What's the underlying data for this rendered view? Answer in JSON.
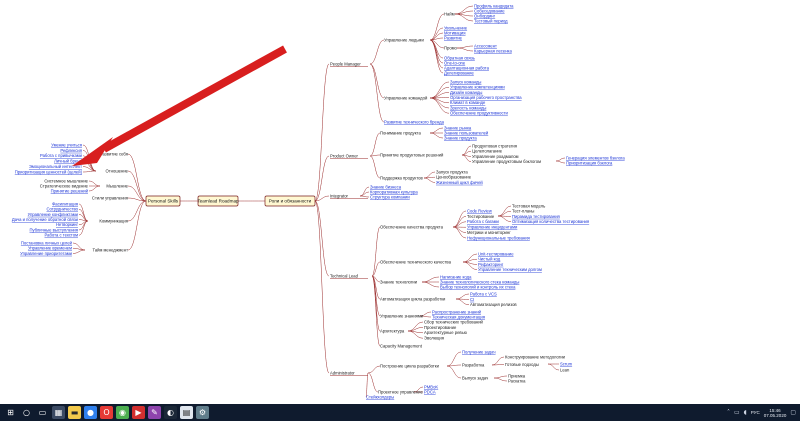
{
  "map": {
    "root": "Teamlead Roadmap",
    "hubs": {
      "personal": "Personal Skills",
      "roles": "Роли и обязанности"
    },
    "personal": [
      {
        "key": "attitude",
        "label": "Отношение",
        "items": [
          {
            "label": "Умение учиться",
            "link": true
          },
          {
            "label": "Рефлексия",
            "link": true
          },
          {
            "label": "Работа с привычками",
            "link": true
          },
          {
            "label": "Личный бренд",
            "link": true
          },
          {
            "label": "Эмоциональный интеллект",
            "link": true
          },
          {
            "label": "Приоритизация ценностей (целей)",
            "link": true
          }
        ],
        "extra": "Развитие себя"
      },
      {
        "key": "thinking",
        "label": "Мышление",
        "items": [
          {
            "label": "Системное мышление",
            "link": false
          },
          {
            "label": "Стратегическое видение",
            "link": false
          },
          {
            "label": "Принятие решений",
            "link": true
          }
        ]
      },
      {
        "key": "mgmt_styles",
        "label": "Стили управления",
        "items": []
      },
      {
        "key": "comm",
        "label": "Коммуникация",
        "items": [
          {
            "label": "Фасилитация",
            "link": true
          },
          {
            "label": "Сотрудничество",
            "link": true
          },
          {
            "label": "Управление конфликтами",
            "link": true
          },
          {
            "label": "Дача и получение обратной связи",
            "link": true
          },
          {
            "label": "Нетворкинг",
            "link": true
          },
          {
            "label": "Публичные выступления",
            "link": true
          },
          {
            "label": "Работа с текстом",
            "link": true
          }
        ]
      },
      {
        "key": "time",
        "label": "Тайм менеджмент",
        "items": [
          {
            "label": "Постановка личных целей",
            "link": true
          },
          {
            "label": "Управление временем",
            "link": true
          },
          {
            "label": "Управление приоритетами",
            "link": true
          }
        ]
      }
    ],
    "roles": {
      "people_manager": {
        "label": "People Manager",
        "hiring": {
          "label": "Найм",
          "items": [
            {
              "label": "Профиль кандидата",
              "link": true
            },
            {
              "label": "Собеседование",
              "link": true
            },
            {
              "label": "Онбординг",
              "link": true
            },
            {
              "label": "Тестовый период",
              "link": true
            }
          ]
        },
        "people_items": [
          {
            "label": "Увольнение",
            "link": true
          },
          {
            "label": "Мотивация",
            "link": true
          },
          {
            "label": "Развитие",
            "link": true
          }
        ],
        "people_label": "Управление людьми",
        "promo": {
          "label": "Промо",
          "items": [
            {
              "label": "Ассессмент",
              "link": true
            },
            {
              "label": "Карьерная лесенка",
              "link": true
            }
          ]
        },
        "people_items2": [
          {
            "label": "Обратная связь",
            "link": true
          },
          {
            "label": "One-to-one",
            "link": true
          },
          {
            "label": "Адаптационная работа",
            "link": true
          },
          {
            "label": "Делегирование",
            "link": true
          }
        ],
        "team_label": "Управление командой",
        "team_items": [
          {
            "label": "Запуск команды",
            "link": true
          },
          {
            "label": "Управление компетенциями",
            "link": true
          },
          {
            "label": "Дизайн команды",
            "link": true
          },
          {
            "label": "Организация рабочего пространства",
            "link": true
          },
          {
            "label": "Климат в команде",
            "link": true
          },
          {
            "label": "Зрелость команды",
            "link": true
          },
          {
            "label": "Обеспечение продуктивности",
            "link": true
          }
        ],
        "tech_brand": {
          "label": "Развитие технического бренда",
          "link": true
        }
      },
      "product_owner": {
        "label": "Product Owner",
        "understand": {
          "label": "Понимание продукта",
          "items": [
            {
              "label": "Знание рынка",
              "link": true
            },
            {
              "label": "Знание пользователей",
              "link": true
            },
            {
              "label": "Знание продукта",
              "link": true
            }
          ]
        },
        "decisions": {
          "label": "Принятие продуктовых решений",
          "items": [
            {
              "label": "Продуктовая стратегия",
              "link": false
            },
            {
              "label": "Целеполагание",
              "link": false
            },
            {
              "label": "Управление роадмапом",
              "link": false
            },
            {
              "label": "Управление продуктовым бэклогом",
              "link": false
            }
          ],
          "backlog_items": [
            {
              "label": "Генерация элементов бэклога",
              "link": true
            },
            {
              "label": "Приоритизация бэклога",
              "link": true
            }
          ]
        },
        "support": {
          "label": "Поддержка продуктов",
          "items": [
            {
              "label": "Запуск продукта",
              "link": false
            },
            {
              "label": "Ценообразование",
              "link": false
            },
            {
              "label": "Жизненный цикл фичей",
              "link": true
            }
          ]
        }
      },
      "integrator": {
        "label": "Integrator",
        "items": [
          {
            "label": "Знание бизнеса",
            "link": true
          },
          {
            "label": "Корпоративная культура",
            "link": true
          },
          {
            "label": "Структура компании",
            "link": true
          }
        ]
      },
      "technical_lead": {
        "label": "Technical Lead",
        "quality": {
          "label": "Обеспечение качества продукта",
          "items": [
            {
              "label": "Code Review",
              "link": true
            },
            {
              "label": "Тестирование",
              "link": false
            },
            {
              "label": "Работа с багами",
              "link": true
            },
            {
              "label": "Управление инцидентами",
              "link": true
            },
            {
              "label": "Метрики и мониторинг",
              "link": false
            },
            {
              "label": "Нефункциональные требования",
              "link": true
            }
          ],
          "testing_items": [
            {
              "label": "Тестовая модель",
              "link": false
            },
            {
              "label": "Тест-планы",
              "link": false
            },
            {
              "label": "Пирамида тестирования",
              "link": true
            },
            {
              "label": "Оптимизация количества тестирования",
              "link": true
            }
          ]
        },
        "tech_quality": {
          "label": "Обеспечение технического качества",
          "items": [
            {
              "label": "Unit-тестирование",
              "link": true
            },
            {
              "label": "Чистый код",
              "link": true
            },
            {
              "label": "Рефакторинг",
              "link": true
            },
            {
              "label": "Управление техническим долгом",
              "link": true
            }
          ]
        },
        "tech_knowledge": {
          "label": "Знание технологии",
          "items": [
            {
              "label": "Написание кода",
              "link": true
            },
            {
              "label": "Знание технологического стека команды",
              "link": true
            },
            {
              "label": "Выбор технологий и контроль их стека",
              "link": true
            }
          ]
        },
        "dev_auto": {
          "label": "Автоматизация цикла разработки",
          "items": [
            {
              "label": "Работа с VCS",
              "link": true
            },
            {
              "label": "CI",
              "link": true
            },
            {
              "label": "Автоматизация релизов",
              "link": false
            }
          ]
        },
        "knowledge": {
          "label": "Управление знаниями",
          "items": [
            {
              "label": "Распространение знаний",
              "link": true
            },
            {
              "label": "Техническая документация",
              "link": true
            }
          ]
        },
        "architecture": {
          "label": "Архитектура",
          "items": [
            {
              "label": "Сбор технических требований",
              "link": false
            },
            {
              "label": "Проектирование",
              "link": false
            },
            {
              "label": "Архитектурные ревью",
              "link": false
            },
            {
              "label": "Эволюция",
              "link": false
            }
          ]
        },
        "capacity": {
          "label": "Capacity Management",
          "link": false
        }
      },
      "administrator": {
        "label": "Administrator",
        "process": {
          "label": "Построение цикла разработки",
          "items": [
            {
              "label": "Получение задач",
              "link": true
            },
            {
              "label": "Разработка",
              "link": false
            },
            {
              "label": "Выпуск задач",
              "link": false
            }
          ],
          "dev_items": [
            {
              "label": "Конструирование методологии",
              "link": false
            },
            {
              "label": "Готовые подходы",
              "link": false
            }
          ],
          "ready_items": [
            {
              "label": "Scrum",
              "link": true
            },
            {
              "label": "Lean",
              "link": false
            }
          ],
          "release_items": [
            {
              "label": "Приемка",
              "link": false
            },
            {
              "label": "Раскатка",
              "link": false
            }
          ]
        },
        "project": {
          "label": "Проектное управление",
          "items": [
            {
              "label": "PMBoK",
              "link": true
            },
            {
              "label": "PDCA",
              "link": true
            }
          ],
          "extra": {
            "label": "Стейкхолдеры",
            "link": true
          }
        }
      }
    }
  },
  "annotation": {
    "arrow_color": "#d81e1e"
  },
  "taskbar": {
    "icons": [
      "windows-logo",
      "search",
      "task-view",
      "calculator",
      "explorer",
      "messenger",
      "opera",
      "chrome",
      "video",
      "paint",
      "steam",
      "notepad",
      "tool"
    ],
    "language": "РУС",
    "time": "15:46",
    "date": "07.05.2020"
  }
}
